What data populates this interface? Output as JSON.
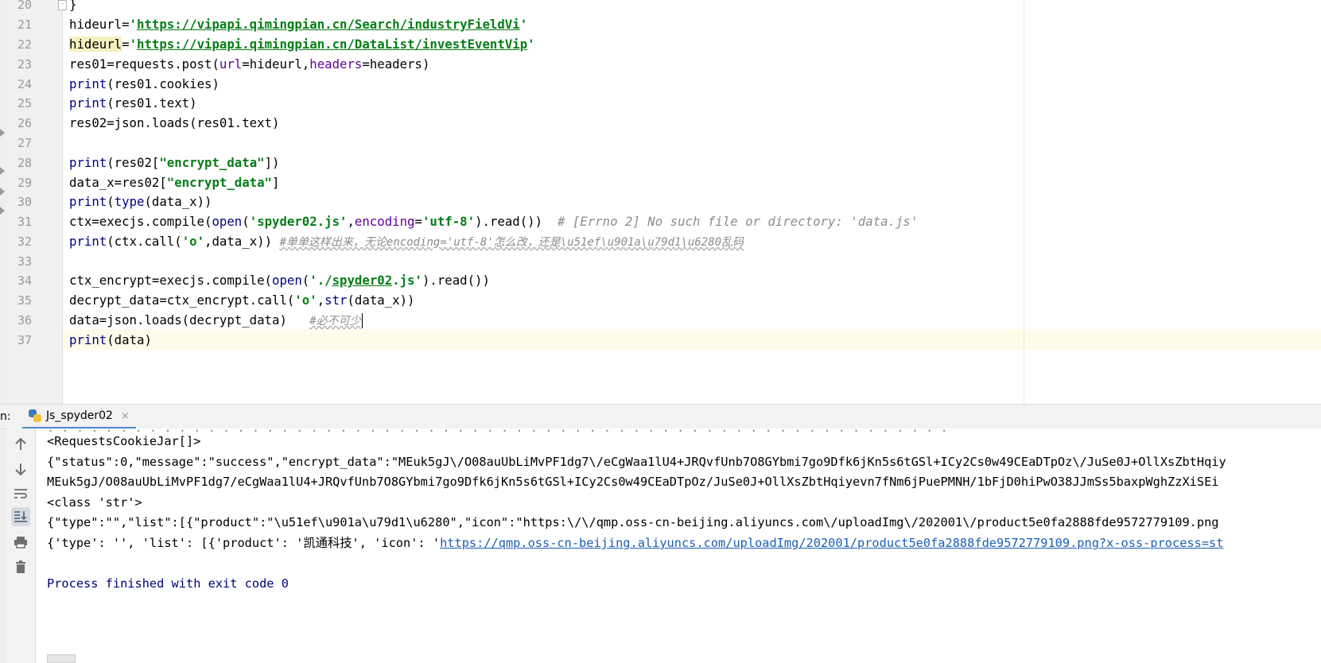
{
  "editor": {
    "line_numbers": [
      "20",
      "21",
      "22",
      "23",
      "24",
      "25",
      "26",
      "27",
      "28",
      "29",
      "30",
      "31",
      "32",
      "33",
      "34",
      "35",
      "36",
      "37"
    ],
    "lines": {
      "l20": {
        "brace": "}"
      },
      "l21": {
        "a": "hideurl=",
        "b": "'",
        "c": "https://vipapi.qimingpian.cn/Search/industryFieldVi",
        "d": "'"
      },
      "l22": {
        "a": "hideurl",
        "b": "=",
        "c": "'",
        "d": "https://vipapi.qimingpian.cn/DataList/investEventVip",
        "e": "'"
      },
      "l23": {
        "a": "res01=requests.post(",
        "b": "url",
        "c": "=hideurl,",
        "d": "headers",
        "e": "=headers)"
      },
      "l24": {
        "a": "print",
        "b": "(res01.cookies)"
      },
      "l25": {
        "a": "print",
        "b": "(res01.text)"
      },
      "l26": {
        "a": "res02=json.loads(res01.text)"
      },
      "l28": {
        "a": "print",
        "b": "(res02[",
        "c": "\"encrypt_data\"",
        "d": "])"
      },
      "l29": {
        "a": "data_x=res02[",
        "b": "\"encrypt_data\"",
        "c": "]"
      },
      "l30": {
        "a": "print",
        "b": "(",
        "c": "type",
        "d": "(data_x))"
      },
      "l31": {
        "a": "ctx=execjs.compile(",
        "b": "open",
        "c": "(",
        "d": "'spyder02.js'",
        "e": ",",
        "f": "encoding",
        "g": "=",
        "h": "'utf-8'",
        "i": ").read())",
        "j": "  # [Errno 2] No such file or directory: 'data.js'"
      },
      "l32": {
        "a": "print",
        "b": "(ctx.call(",
        "c": "'o'",
        "d": ",data_x)) ",
        "e": "#单单这样出来，无论encoding='utf-8'怎么改，还是\\u51ef\\u901a\\u79d1\\u6280乱码"
      },
      "l34": {
        "a": "ctx_encrypt=execjs.compile(",
        "b": "open",
        "c": "(",
        "d": "'./",
        "e": "spyder02",
        "f": ".js'",
        "g": ").read())"
      },
      "l35": {
        "a": "decrypt_data=ctx_encrypt.call(",
        "b": "'o'",
        "c": ",",
        "d": "str",
        "e": "(data_x))"
      },
      "l36": {
        "a": "data=json.loads(decrypt_data)   ",
        "b": "#必不可少"
      },
      "l37": {
        "a": "print",
        "b": "(data)"
      }
    }
  },
  "run_panel": {
    "prefix": "n:",
    "tab_label": "Js_spyder02",
    "tab_close": "×",
    "toolbar_icons": [
      "arrow-up-icon",
      "arrow-down-icon",
      "soft-wrap-icon",
      "scroll-to-end-icon",
      "print-icon",
      "trash-icon"
    ],
    "output": {
      "o1": "<RequestsCookieJar[]>",
      "o2": "{\"status\":0,\"message\":\"success\",\"encrypt_data\":\"MEuk5gJ\\/O08auUbLiMvPF1dg7\\/eCgWaa1lU4+JRQvfUnb7O8GYbmi7go9Dfk6jKn5s6tGSl+ICy2Cs0w49CEaDTpOz\\/JuSe0J+OllXsZbtHqiy",
      "o3": "MEuk5gJ/O08auUbLiMvPF1dg7/eCgWaa1lU4+JRQvfUnb7O8GYbmi7go9Dfk6jKn5s6tGSl+ICy2Cs0w49CEaDTpOz/JuSe0J+OllXsZbtHqiyevn7fNm6jPuePMNH/1bFjD0hiPwO38JJmSs5baxpWghZzXiSEi",
      "o4": "<class 'str'>",
      "o5": "{\"type\":\"\",\"list\":[{\"product\":\"\\u51ef\\u901a\\u79d1\\u6280\",\"icon\":\"https:\\/\\/qmp.oss-cn-beijing.aliyuncs.com\\/uploadImg\\/202001\\/product5e0fa2888fde9572779109.png",
      "o6a": "{'type': '', 'list': [{'product': '",
      "o6b": "凯通科技",
      "o6c": "', 'icon': '",
      "o6d": "https://qmp.oss-cn-beijing.aliyuncs.com/uploadImg/202001/product5e0fa2888fde9572779109.png?x-oss-process=st",
      "exit": "Process finished with exit code 0"
    }
  }
}
